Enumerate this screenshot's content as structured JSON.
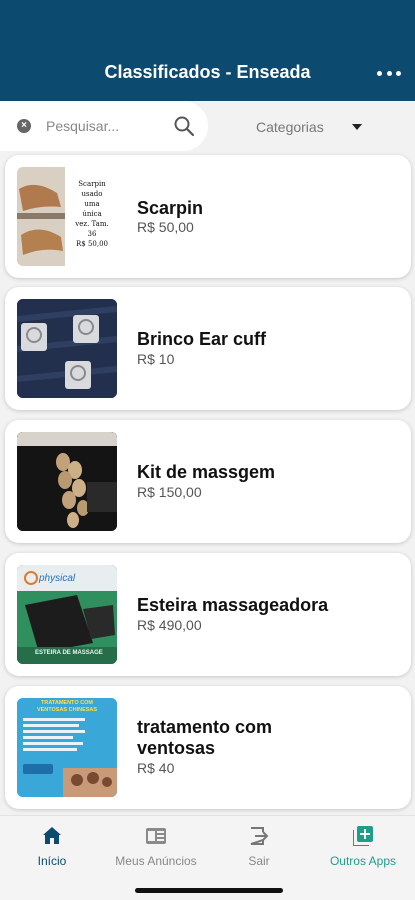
{
  "header": {
    "title": "Classificados - Enseada"
  },
  "search": {
    "placeholder": "Pesquisar...",
    "value": ""
  },
  "category": {
    "label": "Categorias"
  },
  "listings": [
    {
      "title": "Scarpin",
      "price": "R$ 50,00",
      "image_text": [
        "Scarpin",
        "usado",
        "uma",
        "única",
        "vez. Tam.",
        "36",
        "R$ 50,00"
      ]
    },
    {
      "title": "Brinco Ear cuff",
      "price": "R$ 10"
    },
    {
      "title": "Kit de massgem",
      "price": "R$ 150,00"
    },
    {
      "title": "Esteira massageadora",
      "price": "R$ 490,00",
      "image_text": [
        "physical",
        "ESTEIRA DE MASSAGE"
      ]
    },
    {
      "title_line1": "tratamento com",
      "title_line2": "ventosas",
      "price": "R$ 40",
      "image_text": [
        "TRATAMENTO COM",
        "VENTOSAS CHINESAS"
      ]
    }
  ],
  "tabs": [
    {
      "label": "Início",
      "icon": "home-icon",
      "active": true
    },
    {
      "label": "Meus Anúncios",
      "icon": "card-icon",
      "active": false
    },
    {
      "label": "Sair",
      "icon": "exit-icon",
      "active": false
    },
    {
      "label": "Outros Apps",
      "icon": "add-box-icon",
      "active": false
    }
  ],
  "colors": {
    "header_bg": "#0d4a70",
    "tab_active": "#0d4a70",
    "tab_inactive": "#888888",
    "outros_apps": "#1f9d8a"
  }
}
